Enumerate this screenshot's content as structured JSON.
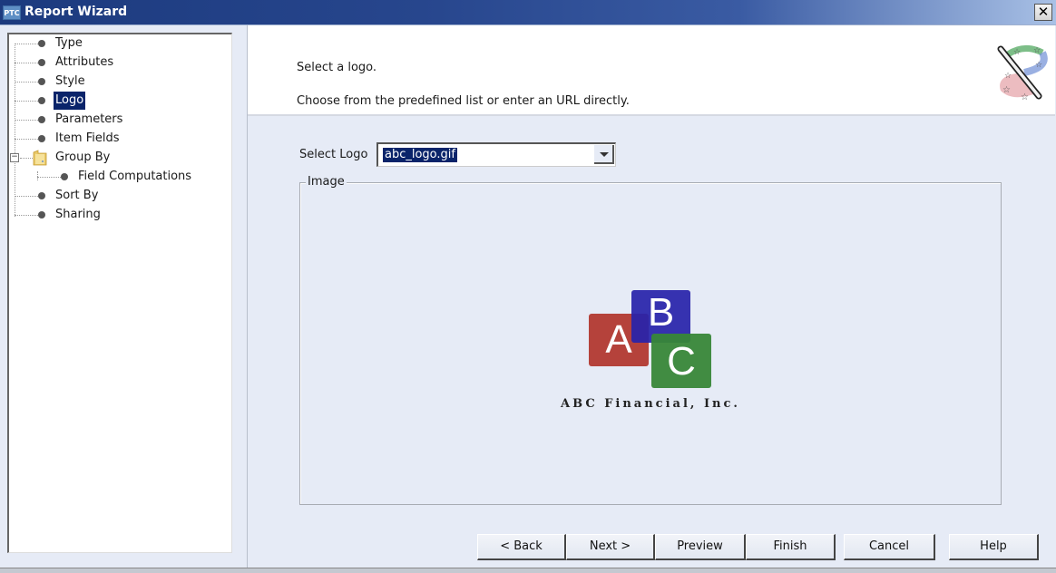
{
  "window": {
    "app_badge": "PTC",
    "title": "Report Wizard",
    "close_label": "✕"
  },
  "tree": {
    "items": [
      {
        "label": "Type",
        "selected": false
      },
      {
        "label": "Attributes",
        "selected": false
      },
      {
        "label": "Style",
        "selected": false
      },
      {
        "label": "Logo",
        "selected": true
      },
      {
        "label": "Parameters",
        "selected": false
      },
      {
        "label": "Item Fields",
        "selected": false
      },
      {
        "label": "Group By",
        "selected": false,
        "expanded": true,
        "icon": "folder-icon",
        "children": [
          {
            "label": "Field Computations",
            "selected": false
          }
        ]
      },
      {
        "label": "Sort By",
        "selected": false
      },
      {
        "label": "Sharing",
        "selected": false
      }
    ],
    "expander_symbol": "−"
  },
  "header": {
    "line1": "Select a logo.",
    "line2": "Choose from the predefined list or enter an URL directly.",
    "icon": "wizard-wand-icon"
  },
  "form": {
    "select_logo_label": "Select Logo",
    "select_logo_value": "abc_logo.gif",
    "image_group_label": "Image"
  },
  "logo_preview": {
    "letters": [
      "A",
      "B",
      "C"
    ],
    "tagline": "ABC Financial, Inc.",
    "colors": {
      "a": "#b5423b",
      "b": "#2823aa",
      "c": "#388738"
    }
  },
  "buttons": {
    "back": "< Back",
    "next": "Next >",
    "preview": "Preview",
    "finish": "Finish",
    "cancel": "Cancel",
    "help": "Help"
  },
  "colors": {
    "titlebar": "#1c3a7e",
    "selection": "#0a246a",
    "panel_bg": "#e6ebf6"
  }
}
